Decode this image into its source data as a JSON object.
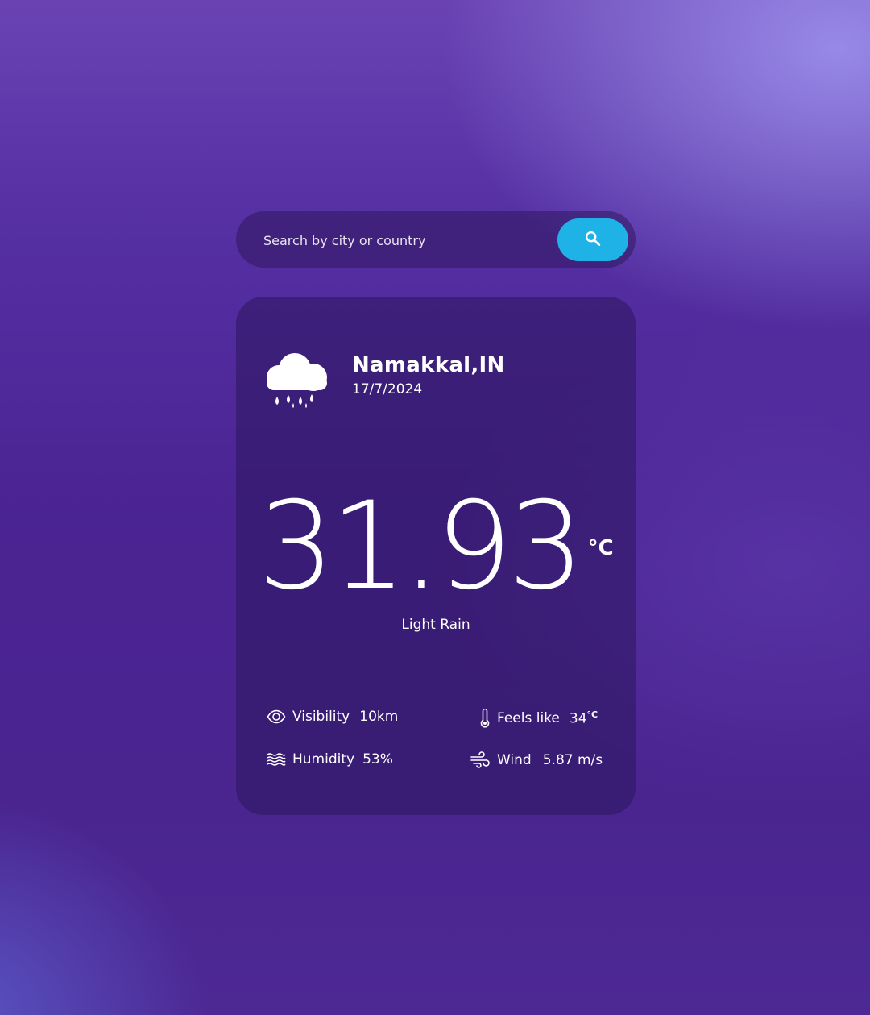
{
  "search": {
    "placeholder": "Search by city or country",
    "button_icon": "search-icon"
  },
  "weather": {
    "icon": "cloud-rain-moon-icon",
    "city": "Namakkal,IN",
    "date": "17/7/2024",
    "temperature": "31.93",
    "temperature_unit": "°C",
    "condition": "Light Rain"
  },
  "stats": {
    "visibility": {
      "icon": "eye-icon",
      "label": "Visibility",
      "value": "10km"
    },
    "feels_like": {
      "icon": "thermometer-icon",
      "label": "Feels like",
      "value": "34",
      "unit": "°C"
    },
    "humidity": {
      "icon": "waves-icon",
      "label": "Humidity",
      "value": "53%"
    },
    "wind": {
      "icon": "wind-icon",
      "label": "Wind",
      "value": "5.87 m/s"
    }
  },
  "colors": {
    "accent": "#1fb2e6",
    "card_background": "#2c165c",
    "background": "#4b2493"
  }
}
